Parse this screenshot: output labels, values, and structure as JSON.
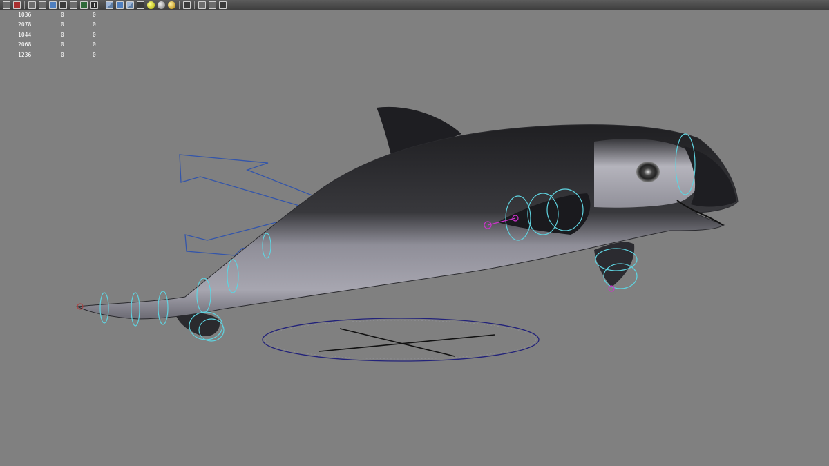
{
  "toolbar": {
    "icons": [
      "select-camera-icon",
      "isolate-select-icon",
      "wireframe-icon",
      "grid-icon",
      "smooth-shade-icon",
      "flat-shade-icon",
      "bounding-box-icon",
      "check-icon",
      "text-icon",
      "cube-wire-icon",
      "cube-shaded-icon",
      "cube-textured-icon",
      "checker-icon",
      "light-sphere-icon",
      "default-material-icon",
      "lit-sphere-icon",
      "camera-gate-icon",
      "resolution-gate-icon",
      "field-chart-icon",
      "safe-action-icon"
    ]
  },
  "hud": {
    "rows": [
      {
        "a": "1036",
        "b": "0",
        "c": "0"
      },
      {
        "a": "2078",
        "b": "0",
        "c": "0"
      },
      {
        "a": "1044",
        "b": "0",
        "c": "0"
      },
      {
        "a": "2068",
        "b": "0",
        "c": "0"
      },
      {
        "a": "1236",
        "b": "0",
        "c": "0"
      }
    ]
  },
  "colors": {
    "viewport_bg": "#808080",
    "rig_control": "#5fd3e0",
    "move_arrow": "#3355aa",
    "joint": "#cc33cc",
    "ground_circle": "#22227a"
  }
}
